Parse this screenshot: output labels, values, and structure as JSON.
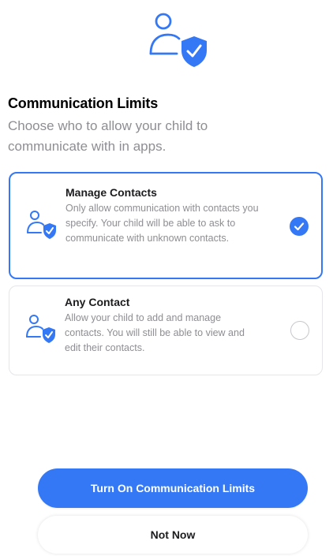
{
  "header": {
    "icon": "person-shield-icon",
    "title": "Communication Limits",
    "subtitle": "Choose who to allow your child to communicate with in apps."
  },
  "options": [
    {
      "icon": "person-shield-icon",
      "title": "Manage Contacts",
      "description": "Only allow communication with contacts you specify. Your child will be able to ask to communicate with unknown contacts.",
      "selected": true
    },
    {
      "icon": "person-shield-icon",
      "title": "Any Contact",
      "description": "Allow your child to add and manage contacts. You will still be able to view and edit their contacts.",
      "selected": false
    }
  ],
  "actions": {
    "primary_label": "Turn On Communication Limits",
    "secondary_label": "Not Now"
  },
  "colors": {
    "accent": "#3478f6",
    "secondary_text": "#8e8e93",
    "border": "#e5e5ea"
  }
}
